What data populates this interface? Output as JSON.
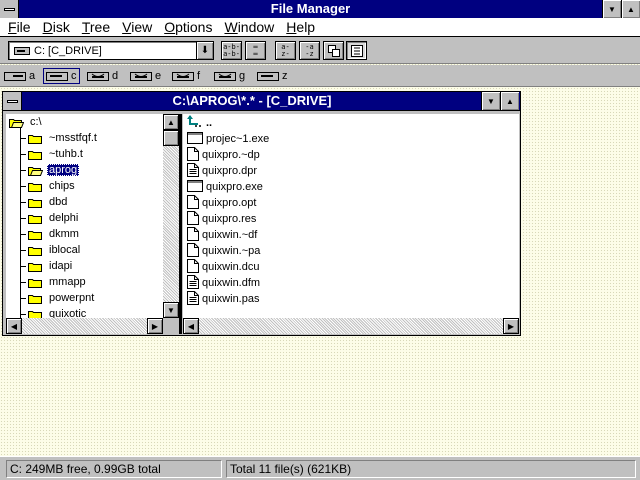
{
  "app": {
    "title": "File Manager"
  },
  "menu": [
    "File",
    "Disk",
    "Tree",
    "View",
    "Options",
    "Window",
    "Help"
  ],
  "menu_underline": [
    "F",
    "D",
    "T",
    "V",
    "O",
    "W",
    "H"
  ],
  "toolbar": {
    "drive_select_value": "C: [C_DRIVE]"
  },
  "drives": [
    "a",
    "c",
    "d",
    "e",
    "f",
    "g",
    "z"
  ],
  "child_window": {
    "title": "C:\\APROG\\*.* - [C_DRIVE]"
  },
  "tree": {
    "root": "c:\\",
    "items": [
      "~msstfqf.t",
      "~tuhb.t",
      "aprog",
      "chips",
      "dbd",
      "delphi",
      "dkmm",
      "iblocal",
      "idapi",
      "mmapp",
      "powerpnt",
      "quixotic"
    ],
    "selected": "aprog"
  },
  "files": [
    {
      "name": "..",
      "icon": "up-arrow-icon"
    },
    {
      "name": "projec~1.exe",
      "icon": "exe-icon"
    },
    {
      "name": "quixpro.~dp",
      "icon": "document-icon"
    },
    {
      "name": "quixpro.dpr",
      "icon": "document-lines-icon"
    },
    {
      "name": "quixpro.exe",
      "icon": "exe-icon"
    },
    {
      "name": "quixpro.opt",
      "icon": "document-icon"
    },
    {
      "name": "quixpro.res",
      "icon": "document-icon"
    },
    {
      "name": "quixwin.~df",
      "icon": "document-icon"
    },
    {
      "name": "quixwin.~pa",
      "icon": "document-icon"
    },
    {
      "name": "quixwin.dcu",
      "icon": "document-icon"
    },
    {
      "name": "quixwin.dfm",
      "icon": "document-lines-icon"
    },
    {
      "name": "quixwin.pas",
      "icon": "document-lines-icon"
    }
  ],
  "status": {
    "disk": "C: 249MB free,  0.99GB total",
    "total": "Total 11 file(s) (621KB)"
  },
  "colors": {
    "titlebar": "#000080",
    "face": "#c0c0c0",
    "desktop": "#fdfde8"
  }
}
